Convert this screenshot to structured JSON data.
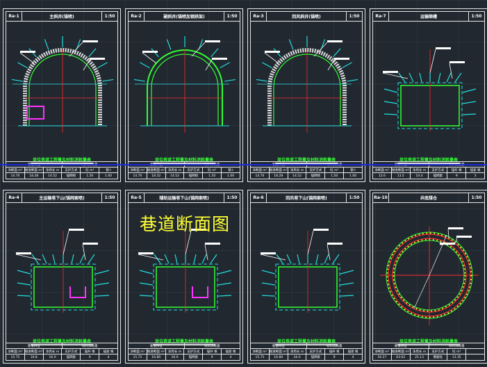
{
  "main_title": "巷道断面图",
  "colors": {
    "frame": "#e8e8e8",
    "support": "#33ff33",
    "rebar": "#ff2a2a",
    "anchor": "#22e0e0",
    "steel": "#ff33ff",
    "bolt_dot": "#ffff33",
    "annotation_line": "#1a2ad8",
    "title_text": "#ffff33"
  },
  "panels": [
    {
      "code": "Ra-1",
      "title": "主斜井(锚喷)",
      "scale": "1:50",
      "shape": "arch",
      "caption": "单位巷道工程量及材料消耗量表",
      "table": {
        "head": [
          "巷道特征",
          "材料消耗量"
        ],
        "cols": [
          "净断面 m²",
          "掘进断面 m²",
          "净周长 m",
          "支护方式",
          "砼 m³",
          "钢 t"
        ],
        "vals": [
          "14.70",
          "18.28",
          "14.52",
          "锚网喷",
          "1.50",
          "1.00"
        ]
      }
    },
    {
      "code": "Ra-2",
      "title": "副斜井(锚喷加钢拱架)",
      "scale": "1:50",
      "shape": "arch",
      "caption": "单位巷道工程量及材料消耗量表",
      "table": {
        "head": [
          "巷道特征",
          "材料消耗量"
        ],
        "cols": [
          "净断面 m²",
          "掘进断面 m²",
          "净周长 m",
          "支护方式",
          "砼 m³",
          "钢 t"
        ],
        "vals": [
          "14.70",
          "18.32",
          "14.52",
          "锚网喷",
          "1.50",
          "1.00"
        ]
      }
    },
    {
      "code": "Ra-3",
      "title": "回风斜井(锚喷)",
      "scale": "1:50",
      "shape": "arch",
      "caption": "单位巷道工程量及材料消耗量表",
      "table": {
        "head": [
          "巷道特征",
          "材料消耗量"
        ],
        "cols": [
          "净断面 m²",
          "掘进断面 m²",
          "净周长 m",
          "支护方式",
          "砼 m³",
          "钢 t"
        ],
        "vals": [
          "14.70",
          "18.28",
          "14.52",
          "锚网喷",
          "1.50",
          "1.00"
        ]
      }
    },
    {
      "code": "Ra-7",
      "title": "运输顺槽",
      "scale": "1:50",
      "shape": "rect",
      "caption": "单位巷道工程量及材料消耗量表",
      "table": {
        "head": [
          "巷道特征",
          "材料消耗量"
        ],
        "cols": [
          "净断面 m²",
          "掘进断面 m²",
          "净周长 m",
          "支护方式",
          "锚杆 根",
          "锚索 根"
        ],
        "vals": [
          "12.6",
          "13.5",
          "14.4",
          "锚网索",
          "9",
          "3"
        ]
      }
    },
    {
      "code": "Ra-4",
      "title": "主运输巷下山(锚网索喷)",
      "scale": "1:50",
      "shape": "rect",
      "caption": "单位巷道工程量及材料消耗量表",
      "table": {
        "head": [
          "巷道特征",
          "材料消耗量"
        ],
        "cols": [
          "净断面 m²",
          "掘进断面 m²",
          "净周长 m",
          "支护方式",
          "锚杆 根",
          "锚索 根"
        ],
        "vals": [
          "15.75",
          "16.8",
          "16.0",
          "锚网索",
          "9",
          "4"
        ]
      }
    },
    {
      "code": "Ra-5",
      "title": "辅助运输巷下山(锚网索喷)",
      "scale": "1:50",
      "shape": "rect",
      "caption": "单位巷道工程量及材料消耗量表",
      "table": {
        "head": [
          "巷道特征",
          "材料消耗量"
        ],
        "cols": [
          "净断面 m²",
          "掘进断面 m²",
          "净周长 m",
          "支护方式",
          "锚杆 根",
          "锚索 根"
        ],
        "vals": [
          "15.75",
          "16.80",
          "16.0",
          "锚网索",
          "9",
          "4"
        ]
      }
    },
    {
      "code": "Ra-6",
      "title": "回风巷下山(锚网索喷)",
      "scale": "1:50",
      "shape": "rect",
      "caption": "单位巷道工程量及材料消耗量表",
      "table": {
        "head": [
          "巷道特征",
          "材料消耗量"
        ],
        "cols": [
          "净断面 m²",
          "掘进断面 m²",
          "净周长 m",
          "支护方式",
          "锚杆 根",
          "锚索 根"
        ],
        "vals": [
          "15.75",
          "16.80",
          "16.0",
          "锚网索",
          "9",
          "4"
        ]
      }
    },
    {
      "code": "Ra-10",
      "title": "井底煤仓",
      "scale": "1:50",
      "shape": "circle",
      "caption": "单位巷道工程量及材料消耗量表",
      "table": {
        "head": [
          "巷道特征",
          "材料消耗量"
        ],
        "cols": [
          "净断面 m²",
          "掘进断面 m²",
          "净周长 m",
          "支护方式",
          "砼 m³",
          ""
        ],
        "vals": [
          "50.27",
          "63.62",
          "25.13",
          "钢筋砼",
          "13.35",
          ""
        ]
      }
    }
  ]
}
